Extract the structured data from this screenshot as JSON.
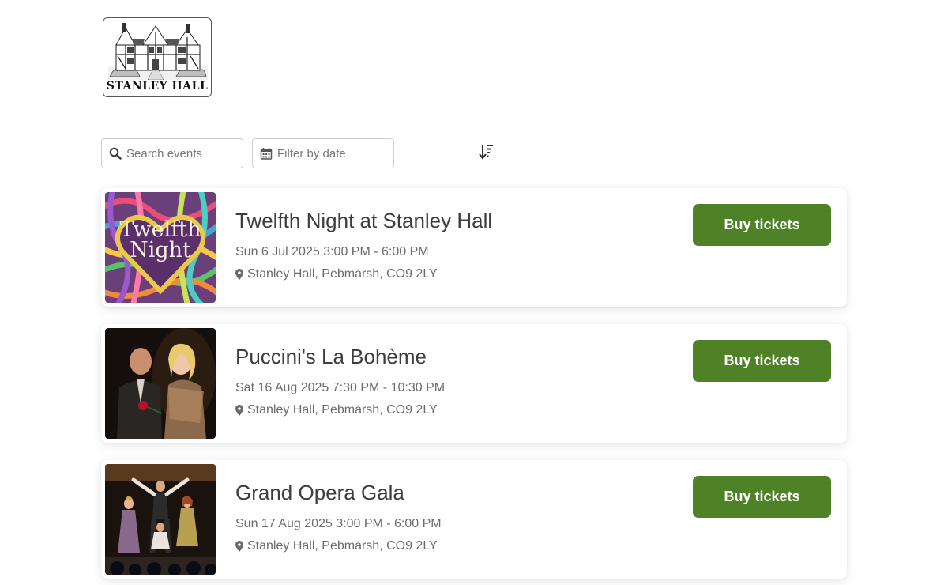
{
  "header": {
    "logo_text": "STANLEY HALL"
  },
  "toolbar": {
    "search_placeholder": "Search events",
    "date_placeholder": "Filter by date"
  },
  "events": [
    {
      "title": "Twelfth Night at Stanley Hall",
      "date": "Sun 6 Jul 2025 3:00 PM - 6:00 PM",
      "venue": "Stanley Hall, Pebmarsh, CO9 2LY",
      "button": "Buy tickets",
      "poster_text_1": "Twelfth",
      "poster_text_2": "Night"
    },
    {
      "title": "Puccini's La Bohème",
      "date": "Sat 16 Aug 2025 7:30 PM - 10:30 PM",
      "venue": "Stanley Hall, Pebmarsh, CO9 2LY",
      "button": "Buy tickets"
    },
    {
      "title": "Grand Opera Gala",
      "date": "Sun 17 Aug 2025 3:00 PM - 6:00 PM",
      "venue": "Stanley Hall, Pebmarsh, CO9 2LY",
      "button": "Buy tickets"
    }
  ],
  "colors": {
    "button_bg": "#4f8126",
    "button_text": "#ffffff",
    "title_text": "#3d3d3d",
    "meta_text": "#6b6b6b"
  },
  "icons": {
    "search": "search-icon",
    "calendar": "calendar-icon",
    "sort": "sort-icon",
    "location": "map-pin-icon"
  }
}
